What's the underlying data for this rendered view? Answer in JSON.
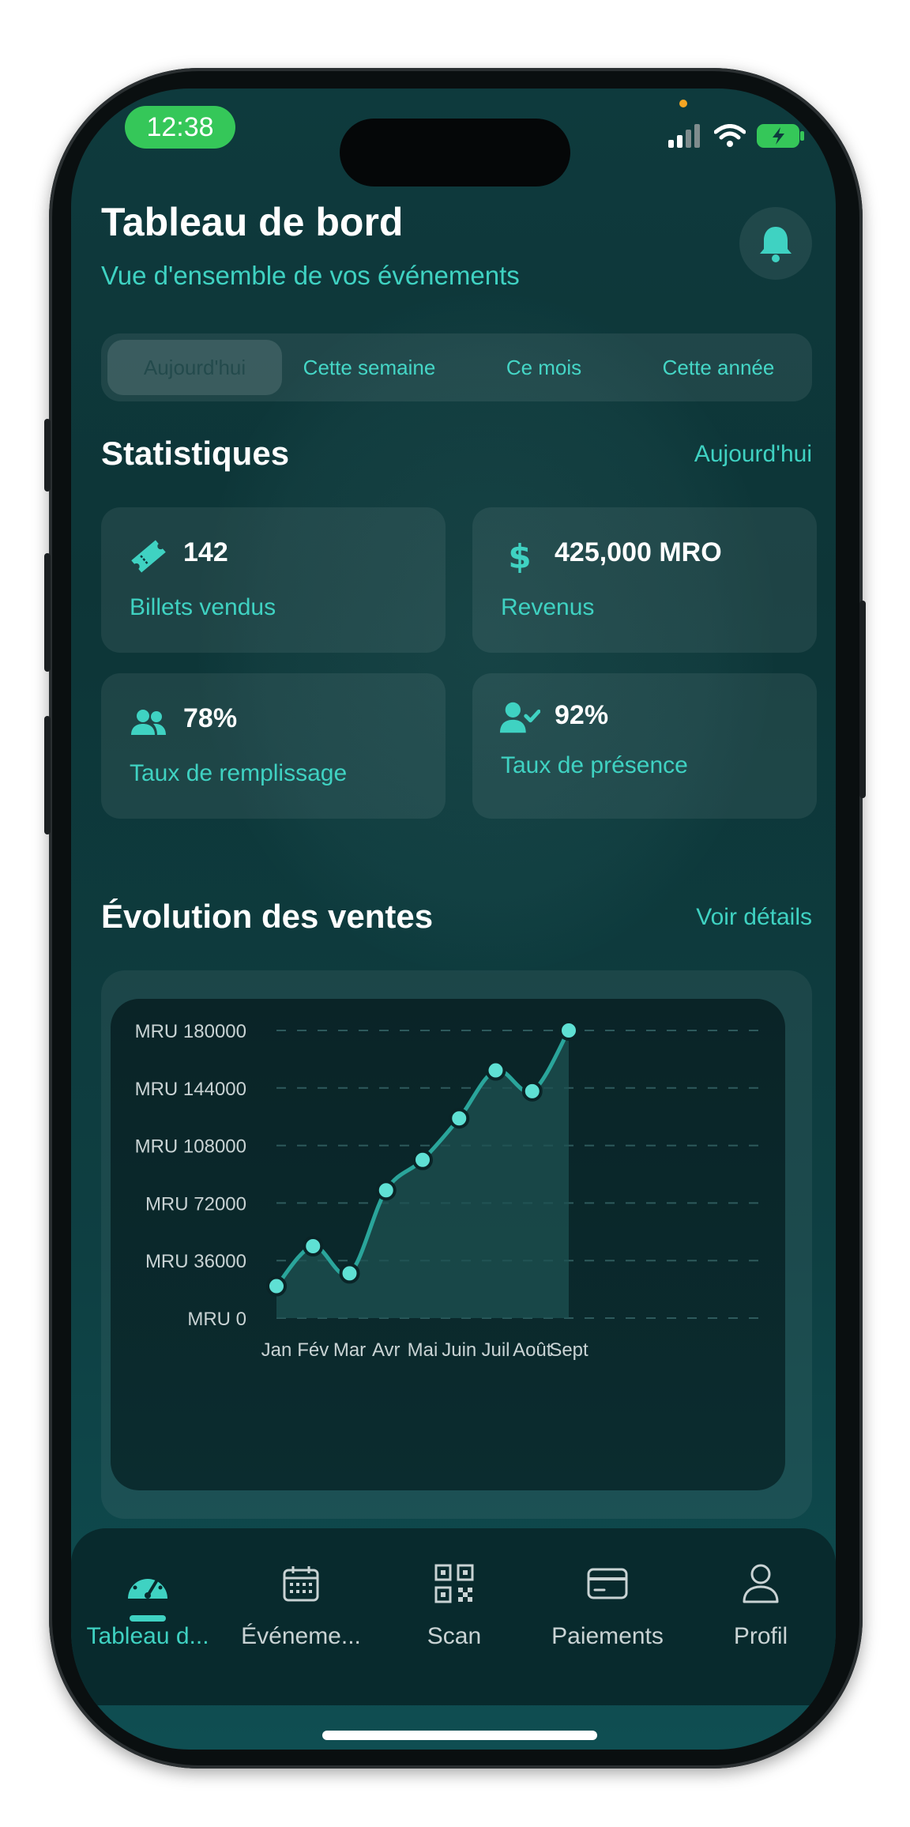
{
  "status_bar": {
    "time": "12:38"
  },
  "header": {
    "title": "Tableau de bord",
    "subtitle": "Vue d'ensemble de vos événements",
    "notification_icon": "bell-icon"
  },
  "period_tabs": [
    {
      "label": "Aujourd'hui",
      "active": true
    },
    {
      "label": "Cette semaine",
      "active": false
    },
    {
      "label": "Ce mois",
      "active": false
    },
    {
      "label": "Cette année",
      "active": false
    }
  ],
  "stats_section": {
    "title": "Statistiques",
    "period_label": "Aujourd'hui",
    "cards": [
      {
        "icon": "ticket-icon",
        "value": "142",
        "label": "Billets vendus"
      },
      {
        "icon": "dollar-icon",
        "value": "425,000 MRO",
        "label": "Revenus"
      },
      {
        "icon": "users-icon",
        "value": "78%",
        "label": "Taux de remplissage"
      },
      {
        "icon": "user-check-icon",
        "value": "92%",
        "label": "Taux de présence"
      }
    ]
  },
  "sales_section": {
    "title": "Évolution des ventes",
    "link": "Voir détails"
  },
  "chart_data": {
    "type": "area",
    "categories": [
      "Jan",
      "Fév",
      "Mar",
      "Avr",
      "Mai",
      "Juin",
      "Juil",
      "Août",
      "Sept"
    ],
    "series": [
      {
        "values": [
          20000,
          45000,
          28000,
          80000,
          99000,
          125000,
          155000,
          142000,
          180000
        ]
      }
    ],
    "y_ticks": [
      "MRU 0",
      "MRU 36000",
      "MRU 72000",
      "MRU 108000",
      "MRU 144000",
      "MRU 180000"
    ],
    "ylim": [
      0,
      180000
    ],
    "grid": true,
    "colors": {
      "line": "#2aa59b",
      "point": "#5fe0d4",
      "fill": "#1d5152"
    }
  },
  "bottom_nav": [
    {
      "icon": "dashboard-icon",
      "label": "Tableau d...",
      "active": true
    },
    {
      "icon": "calendar-icon",
      "label": "Événeme...",
      "active": false
    },
    {
      "icon": "qr-code-icon",
      "label": "Scan",
      "active": false
    },
    {
      "icon": "credit-card-icon",
      "label": "Paiements",
      "active": false
    },
    {
      "icon": "user-icon",
      "label": "Profil",
      "active": false
    }
  ],
  "colors": {
    "accent": "#3fd2c2",
    "background": "#0e3a3d",
    "status_time_bg": "#35c759"
  }
}
